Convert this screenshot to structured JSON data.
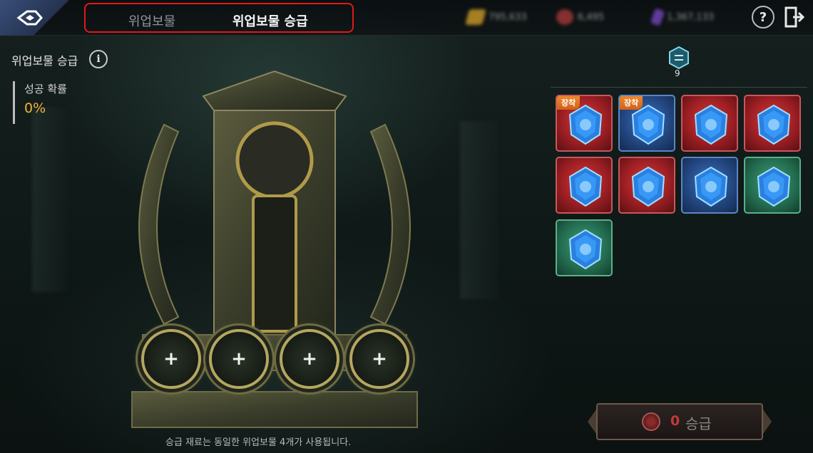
{
  "header": {
    "tabs": [
      {
        "label": "위업보물",
        "active": false
      },
      {
        "label": "위업보물 승급",
        "active": true
      }
    ],
    "currencies": [
      {
        "icon": "gold-bar-icon",
        "value": "795,633",
        "color": "#d9a42a"
      },
      {
        "icon": "red-gem-icon",
        "value": "6,495",
        "color": "#b03a3a"
      },
      {
        "icon": "purple-crystal-icon",
        "value": "1,367,133",
        "color": "#7a4ac8"
      }
    ],
    "help_label": "?"
  },
  "left": {
    "title": "위업보물 승급",
    "info_label": "i",
    "success_label": "성공 확률",
    "success_value": "0%"
  },
  "altar": {
    "slots": [
      "+",
      "+",
      "+",
      "+"
    ],
    "hint": "승급 재료는 동일한 위업보물 4개가 사용됩니다."
  },
  "right": {
    "tier_badge_icon": "tier-emblem-icon",
    "tier_number": "9",
    "items": [
      {
        "rarity": "red",
        "tag": "장착",
        "icon": "blue-gem-icon"
      },
      {
        "rarity": "blue",
        "tag": "장착",
        "icon": "blue-gem-icon"
      },
      {
        "rarity": "red",
        "tag": "",
        "icon": "blue-gem-icon"
      },
      {
        "rarity": "red",
        "tag": "",
        "icon": "blue-gem-icon"
      },
      {
        "rarity": "red",
        "tag": "",
        "icon": "blue-gem-icon"
      },
      {
        "rarity": "red",
        "tag": "",
        "icon": "blue-gem-icon"
      },
      {
        "rarity": "blue",
        "tag": "",
        "icon": "blue-gem-icon"
      },
      {
        "rarity": "green",
        "tag": "",
        "icon": "blue-gem-icon"
      },
      {
        "rarity": "green",
        "tag": "",
        "icon": "blue-gem-icon"
      }
    ]
  },
  "upgrade": {
    "cost": "0",
    "label": "승급"
  }
}
